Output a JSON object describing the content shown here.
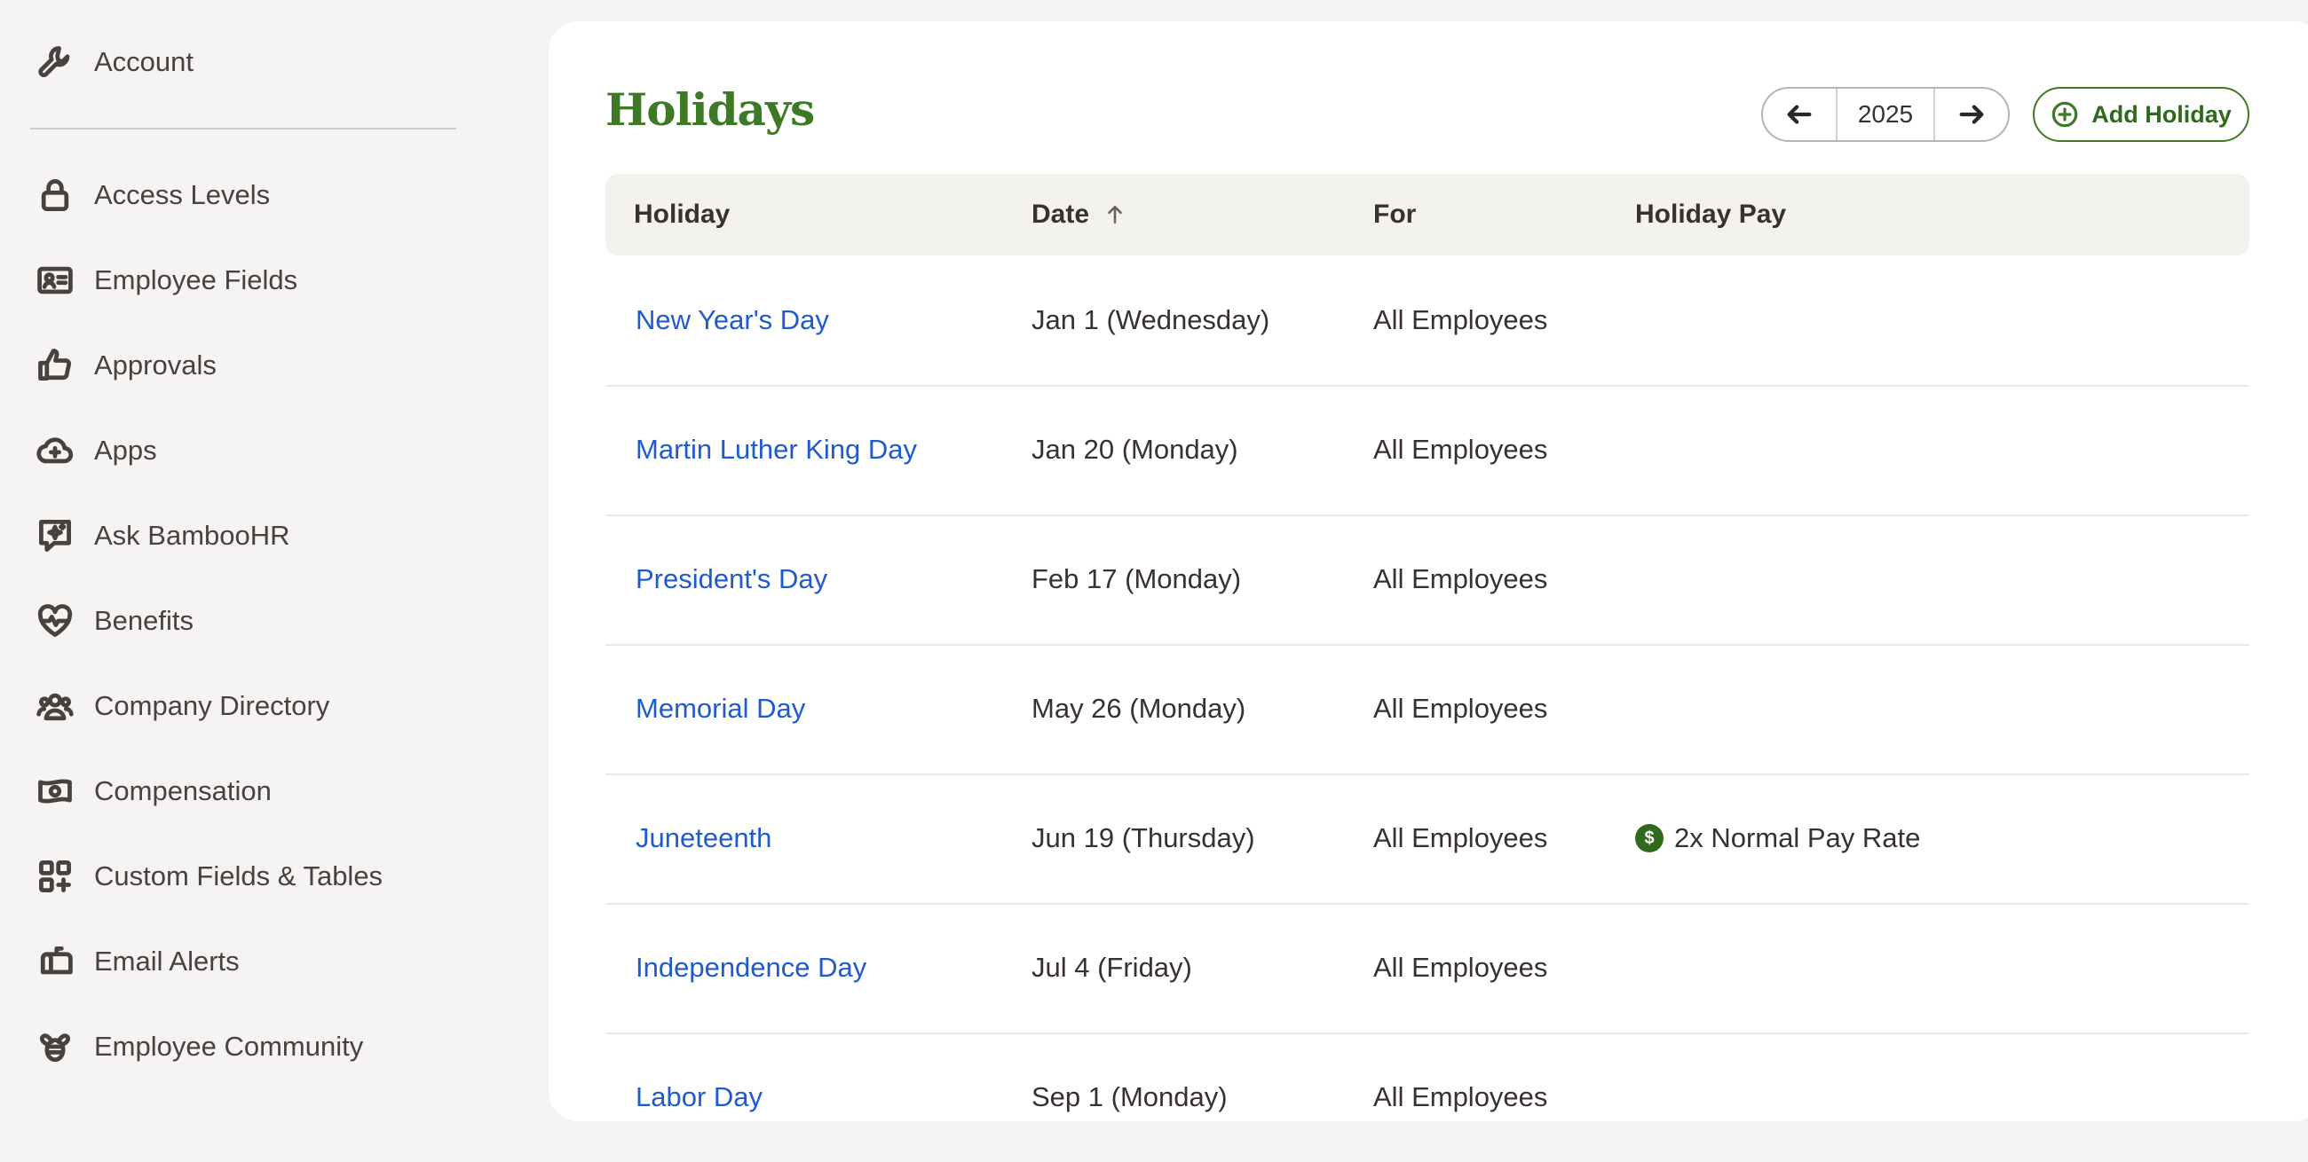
{
  "sidebar": {
    "account": {
      "label": "Account",
      "icon": "wrench-icon"
    },
    "items": [
      {
        "label": "Access Levels",
        "icon": "lock-icon"
      },
      {
        "label": "Employee Fields",
        "icon": "id-card-icon"
      },
      {
        "label": "Approvals",
        "icon": "thumbs-up-icon"
      },
      {
        "label": "Apps",
        "icon": "cloud-plus-icon"
      },
      {
        "label": "Ask BambooHR",
        "icon": "sparkle-chat-icon"
      },
      {
        "label": "Benefits",
        "icon": "heart-pulse-icon"
      },
      {
        "label": "Company Directory",
        "icon": "people-icon"
      },
      {
        "label": "Compensation",
        "icon": "money-icon"
      },
      {
        "label": "Custom Fields & Tables",
        "icon": "grid-plus-icon"
      },
      {
        "label": "Email Alerts",
        "icon": "mailbox-icon"
      },
      {
        "label": "Employee Community",
        "icon": "bee-icon"
      }
    ]
  },
  "main": {
    "title": "Holidays",
    "year": "2025",
    "add_label": "Add Holiday",
    "columns": {
      "holiday": "Holiday",
      "date": "Date",
      "for": "For",
      "pay": "Holiday Pay"
    },
    "rows": [
      {
        "holiday": "New Year's Day",
        "date": "Jan 1 (Wednesday)",
        "for": "All Employees",
        "pay": ""
      },
      {
        "holiday": "Martin Luther King Day",
        "date": "Jan 20 (Monday)",
        "for": "All Employees",
        "pay": ""
      },
      {
        "holiday": "President's Day",
        "date": "Feb 17 (Monday)",
        "for": "All Employees",
        "pay": ""
      },
      {
        "holiday": "Memorial Day",
        "date": "May 26 (Monday)",
        "for": "All Employees",
        "pay": ""
      },
      {
        "holiday": "Juneteenth",
        "date": "Jun 19 (Thursday)",
        "for": "All Employees",
        "pay": "2x Normal Pay Rate",
        "pay_icon": "$"
      },
      {
        "holiday": "Independence Day",
        "date": "Jul 4 (Friday)",
        "for": "All Employees",
        "pay": ""
      },
      {
        "holiday": "Labor Day",
        "date": "Sep 1 (Monday)",
        "for": "All Employees",
        "pay": ""
      }
    ]
  },
  "colors": {
    "brand_green": "#3e7a25",
    "link_blue": "#1f5bcf",
    "sidebar_bg": "#f5f4f2"
  }
}
